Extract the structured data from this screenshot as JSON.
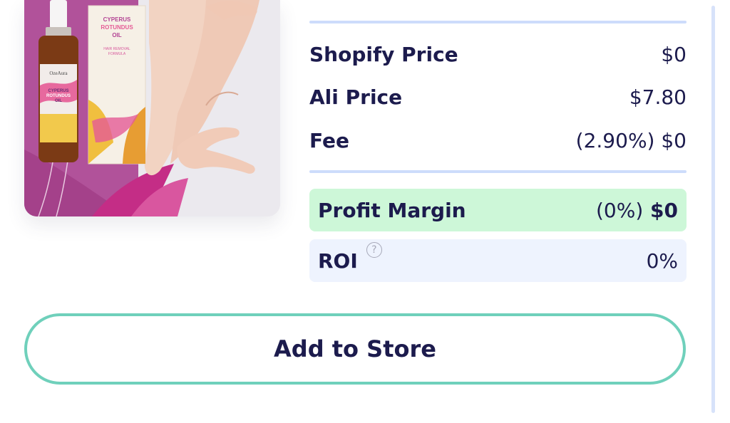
{
  "product": {
    "image_alt": "Cyperus Rotundus Oil product image",
    "brand_text": "OzeAura",
    "box_text": "CYPERUS ROTUNDUS OIL",
    "box_subtext": "HAIR REMOVAL FORMULA"
  },
  "pricing": {
    "shopify_label": "Shopify Price",
    "shopify_value": "$0",
    "ali_label": "Ali Price",
    "ali_value": "$7.80",
    "fee_label": "Fee",
    "fee_value": "(2.90%) $0"
  },
  "profit": {
    "label": "Profit Margin",
    "percent": "(0%)",
    "amount": "$0"
  },
  "roi": {
    "label": "ROI",
    "help_icon": "question-circle-icon",
    "help_glyph": "?",
    "value": "0%"
  },
  "actions": {
    "add_to_store_label": "Add to Store"
  },
  "colors": {
    "text": "#1c1b4d",
    "divider": "#cddcfb",
    "profit_bg": "#cdf7d8",
    "roi_bg": "#eef3fe",
    "button_border": "#6fd0bb"
  }
}
